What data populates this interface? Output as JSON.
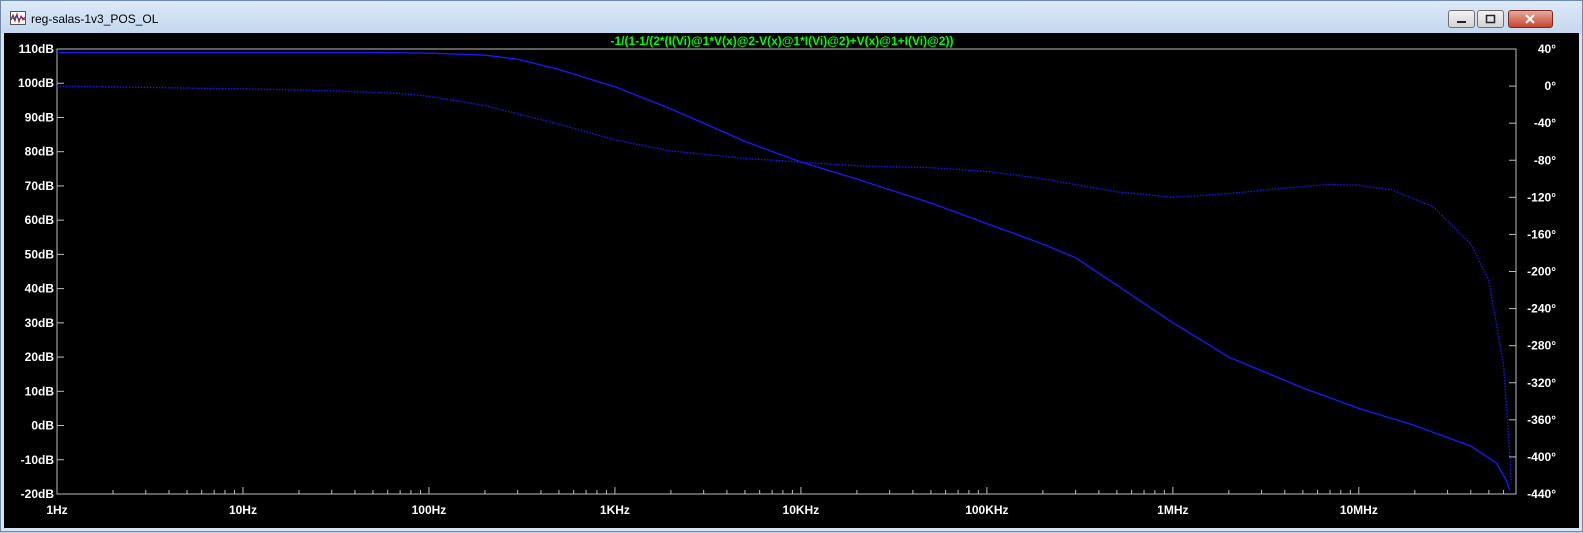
{
  "window": {
    "title": "reg-salas-1v3_POS_OL",
    "icon": "waveform-icon"
  },
  "colors": {
    "background": "#000000",
    "axis": "#bdbdbd",
    "labels": "#ffffff",
    "expression": "#00ff00",
    "trace": "#1a1aff"
  },
  "chart_data": {
    "type": "line",
    "title": "-1/(1-1/(2*(I(Vi)@1*V(x)@2-V(x)@1*I(Vi)@2)+V(x)@1+I(Vi)@2))",
    "xlabel": "",
    "ylabel": "",
    "xscale": "log",
    "xlim": [
      1,
      70000000
    ],
    "ylim": [
      -20,
      110
    ],
    "y2lim": [
      -440,
      40
    ],
    "grid": false,
    "x_ticks": [
      {
        "value": 1,
        "label": "1Hz"
      },
      {
        "value": 10,
        "label": "10Hz"
      },
      {
        "value": 100,
        "label": "100Hz"
      },
      {
        "value": 1000,
        "label": "1KHz"
      },
      {
        "value": 10000,
        "label": "10KHz"
      },
      {
        "value": 100000,
        "label": "100KHz"
      },
      {
        "value": 1000000,
        "label": "1MHz"
      },
      {
        "value": 10000000,
        "label": "10MHz"
      }
    ],
    "y_ticks": [
      {
        "value": 110,
        "label": "110dB"
      },
      {
        "value": 100,
        "label": "100dB"
      },
      {
        "value": 90,
        "label": "90dB"
      },
      {
        "value": 80,
        "label": "80dB"
      },
      {
        "value": 70,
        "label": "70dB"
      },
      {
        "value": 60,
        "label": "60dB"
      },
      {
        "value": 50,
        "label": "50dB"
      },
      {
        "value": 40,
        "label": "40dB"
      },
      {
        "value": 30,
        "label": "30dB"
      },
      {
        "value": 20,
        "label": "20dB"
      },
      {
        "value": 10,
        "label": "10dB"
      },
      {
        "value": 0,
        "label": "0dB"
      },
      {
        "value": -10,
        "label": "-10dB"
      },
      {
        "value": -20,
        "label": "-20dB"
      }
    ],
    "y2_ticks": [
      {
        "value": 40,
        "label": "40°"
      },
      {
        "value": 0,
        "label": "0°"
      },
      {
        "value": -40,
        "label": "-40°"
      },
      {
        "value": -80,
        "label": "-80°"
      },
      {
        "value": -120,
        "label": "-120°"
      },
      {
        "value": -160,
        "label": "-160°"
      },
      {
        "value": -200,
        "label": "-200°"
      },
      {
        "value": -240,
        "label": "-240°"
      },
      {
        "value": -280,
        "label": "-280°"
      },
      {
        "value": -320,
        "label": "-320°"
      },
      {
        "value": -360,
        "label": "-360°"
      },
      {
        "value": -400,
        "label": "-400°"
      },
      {
        "value": -440,
        "label": "-440°"
      }
    ],
    "series": [
      {
        "axis": "left",
        "style": "solid",
        "points": [
          [
            1,
            109
          ],
          [
            10,
            109
          ],
          [
            50,
            109
          ],
          [
            100,
            108.8
          ],
          [
            200,
            108.2
          ],
          [
            300,
            107
          ],
          [
            500,
            104
          ],
          [
            1000,
            99
          ],
          [
            2000,
            92.5
          ],
          [
            5000,
            83
          ],
          [
            10000,
            77
          ],
          [
            20000,
            72
          ],
          [
            50000,
            65
          ],
          [
            100000,
            59
          ],
          [
            200000,
            53
          ],
          [
            300000,
            49
          ],
          [
            500000,
            41
          ],
          [
            1000000,
            30
          ],
          [
            2000000,
            20
          ],
          [
            5000000,
            11
          ],
          [
            10000000,
            5
          ],
          [
            20000000,
            0
          ],
          [
            40000000,
            -6
          ],
          [
            55000000,
            -11
          ],
          [
            62000000,
            -16
          ],
          [
            65000000,
            -19
          ]
        ]
      },
      {
        "axis": "right",
        "style": "dotted",
        "points": [
          [
            1,
            0
          ],
          [
            10,
            -3
          ],
          [
            30,
            -5
          ],
          [
            70,
            -8
          ],
          [
            100,
            -11
          ],
          [
            200,
            -21
          ],
          [
            500,
            -41
          ],
          [
            1000,
            -58
          ],
          [
            2000,
            -70
          ],
          [
            5000,
            -78
          ],
          [
            10000,
            -82
          ],
          [
            20000,
            -86
          ],
          [
            50000,
            -88
          ],
          [
            100000,
            -92
          ],
          [
            200000,
            -100
          ],
          [
            500000,
            -114
          ],
          [
            1000000,
            -120
          ],
          [
            2000000,
            -116
          ],
          [
            4000000,
            -110
          ],
          [
            7000000,
            -106
          ],
          [
            10000000,
            -107
          ],
          [
            15000000,
            -112
          ],
          [
            25000000,
            -130
          ],
          [
            40000000,
            -170
          ],
          [
            50000000,
            -210
          ],
          [
            60000000,
            -300
          ],
          [
            65000000,
            -400
          ],
          [
            66000000,
            -430
          ]
        ]
      }
    ]
  }
}
